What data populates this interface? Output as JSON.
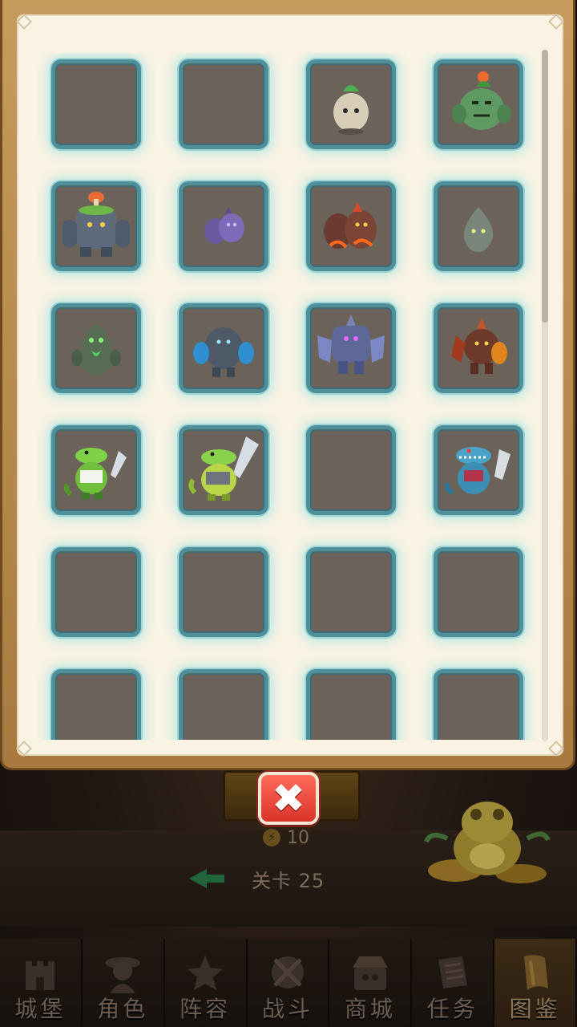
{
  "energy": {
    "icon": "lightning-icon",
    "value": "10"
  },
  "stage": {
    "label": "关卡 25"
  },
  "close": {
    "label": "✖",
    "icon": "close-icon"
  },
  "codex": {
    "slots": [
      {
        "monster": null
      },
      {
        "monster": null
      },
      {
        "monster": "stone-sprout"
      },
      {
        "monster": "flower-golem"
      },
      {
        "monster": "mushroom-golem"
      },
      {
        "monster": "purple-rock-imps"
      },
      {
        "monster": "lava-rock-imps"
      },
      {
        "monster": "grey-pebble"
      },
      {
        "monster": "moss-rune-golem"
      },
      {
        "monster": "blue-crystal-golem"
      },
      {
        "monster": "purple-crystal-titan"
      },
      {
        "monster": "magma-spike-golem"
      },
      {
        "monster": "croc-warrior"
      },
      {
        "monster": "armored-croc"
      },
      {
        "monster": null
      },
      {
        "monster": "blue-croc-butcher"
      },
      {
        "monster": null
      },
      {
        "monster": null
      },
      {
        "monster": null
      },
      {
        "monster": null
      },
      {
        "monster": null
      },
      {
        "monster": null
      },
      {
        "monster": null
      },
      {
        "monster": null
      }
    ]
  },
  "nav": [
    {
      "label": "城堡",
      "icon": "castle-icon"
    },
    {
      "label": "角色",
      "icon": "hero-icon"
    },
    {
      "label": "阵容",
      "icon": "formation-icon"
    },
    {
      "label": "战斗",
      "icon": "battle-icon"
    },
    {
      "label": "商城",
      "icon": "shop-icon"
    },
    {
      "label": "任务",
      "icon": "quest-scroll-icon"
    },
    {
      "label": "图鉴",
      "icon": "codex-icon"
    }
  ],
  "colors": {
    "panel": "#f8f3e3",
    "frame": "#b8874a",
    "slot": "#6b6359",
    "slot_border": "#4f8f9a",
    "close": "#e0443a"
  }
}
